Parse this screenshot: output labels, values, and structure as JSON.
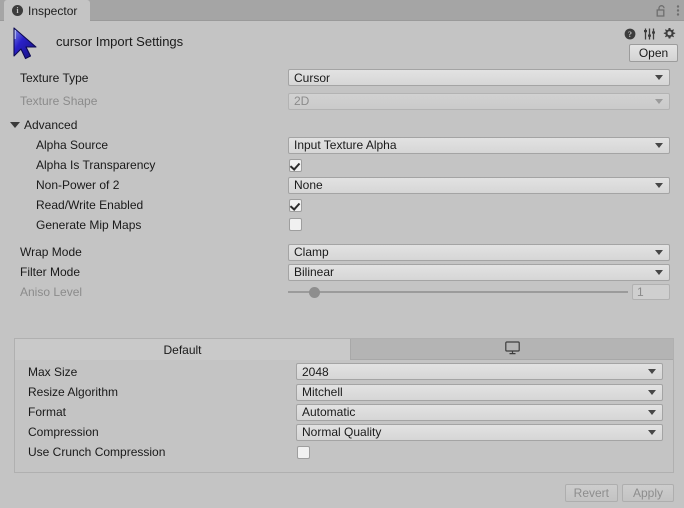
{
  "window": {
    "tab_label": "Inspector",
    "tab_icon": "info-icon",
    "lock_icon": "lock-open-icon",
    "menu_icon": "vertical-dots-icon"
  },
  "header": {
    "asset_icon": "cursor-arrow-icon",
    "title": "cursor Import Settings",
    "help_icon": "help-icon",
    "preset_icon": "preset-sliders-icon",
    "gear_icon": "gear-icon",
    "open_label": "Open"
  },
  "main_rows": [
    {
      "label": "Texture Type",
      "type": "dropdown",
      "value": "Cursor",
      "disabled": false,
      "indent": 0
    },
    {
      "label": "Texture Shape",
      "type": "dropdown",
      "value": "2D",
      "disabled": true,
      "indent": 0
    }
  ],
  "advanced": {
    "foldout_label": "Advanced",
    "expanded": true,
    "rows": [
      {
        "label": "Alpha Source",
        "type": "dropdown",
        "value": "Input Texture Alpha",
        "disabled": false,
        "indent": 1
      },
      {
        "label": "Alpha Is Transparency",
        "type": "checkbox",
        "checked": true,
        "disabled": false,
        "indent": 1
      },
      {
        "label": "Non-Power of 2",
        "type": "dropdown",
        "value": "None",
        "disabled": false,
        "indent": 1
      },
      {
        "label": "Read/Write Enabled",
        "type": "checkbox",
        "checked": true,
        "disabled": false,
        "indent": 1
      },
      {
        "label": "Generate Mip Maps",
        "type": "checkbox",
        "checked": false,
        "disabled": false,
        "indent": 1
      }
    ]
  },
  "filter_rows": [
    {
      "label": "Wrap Mode",
      "type": "dropdown",
      "value": "Clamp",
      "disabled": false,
      "indent": 0
    },
    {
      "label": "Filter Mode",
      "type": "dropdown",
      "value": "Bilinear",
      "disabled": false,
      "indent": 0
    }
  ],
  "aniso": {
    "label": "Aniso Level",
    "disabled": true,
    "value": "1",
    "slider_min": 0,
    "slider_max": 16,
    "slider_position_percent": 6
  },
  "platform_panel": {
    "tabs": [
      {
        "label": "Default",
        "icon": null,
        "selected": true
      },
      {
        "label": "",
        "icon": "monitor-icon",
        "selected": false
      }
    ],
    "rows": [
      {
        "label": "Max Size",
        "type": "dropdown",
        "value": "2048",
        "disabled": false
      },
      {
        "label": "Resize Algorithm",
        "type": "dropdown",
        "value": "Mitchell",
        "disabled": false
      },
      {
        "label": "Format",
        "type": "dropdown",
        "value": "Automatic",
        "disabled": false
      },
      {
        "label": "Compression",
        "type": "dropdown",
        "value": "Normal Quality",
        "disabled": false
      },
      {
        "label": "Use Crunch Compression",
        "type": "checkbox",
        "checked": false,
        "disabled": false
      }
    ]
  },
  "footer": {
    "revert_label": "Revert",
    "apply_label": "Apply",
    "buttons_disabled": true
  },
  "colors": {
    "background": "#c4c4c4",
    "tabbar": "#a5a5a5",
    "field": "#dcdcdc",
    "disabled_text": "#8b8b8b",
    "text": "#1a1a1a",
    "cursor_blue": "#2a20c8"
  }
}
